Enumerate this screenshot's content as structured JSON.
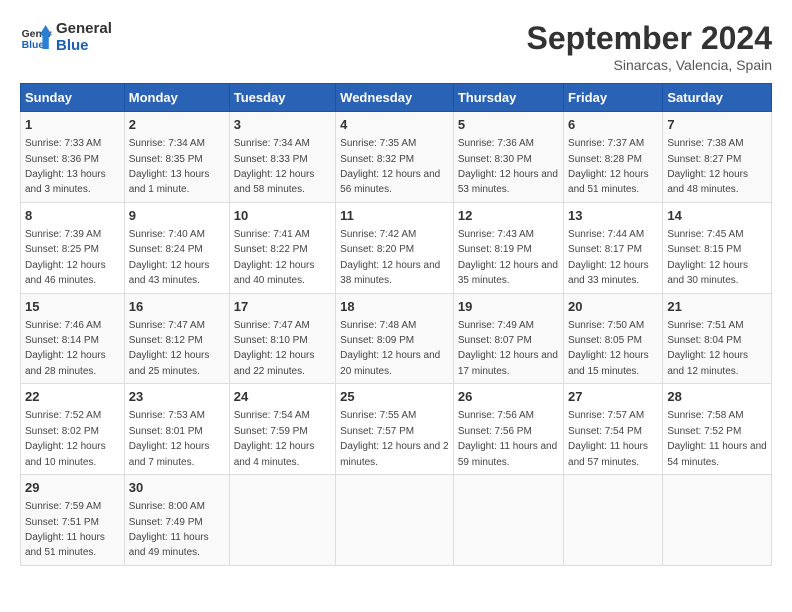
{
  "header": {
    "logo_line1": "General",
    "logo_line2": "Blue",
    "month_title": "September 2024",
    "location": "Sinarcas, Valencia, Spain"
  },
  "columns": [
    "Sunday",
    "Monday",
    "Tuesday",
    "Wednesday",
    "Thursday",
    "Friday",
    "Saturday"
  ],
  "weeks": [
    [
      {
        "day": "1",
        "sunrise": "7:33 AM",
        "sunset": "8:36 PM",
        "daylight": "13 hours and 3 minutes."
      },
      {
        "day": "2",
        "sunrise": "7:34 AM",
        "sunset": "8:35 PM",
        "daylight": "13 hours and 1 minute."
      },
      {
        "day": "3",
        "sunrise": "7:34 AM",
        "sunset": "8:33 PM",
        "daylight": "12 hours and 58 minutes."
      },
      {
        "day": "4",
        "sunrise": "7:35 AM",
        "sunset": "8:32 PM",
        "daylight": "12 hours and 56 minutes."
      },
      {
        "day": "5",
        "sunrise": "7:36 AM",
        "sunset": "8:30 PM",
        "daylight": "12 hours and 53 minutes."
      },
      {
        "day": "6",
        "sunrise": "7:37 AM",
        "sunset": "8:28 PM",
        "daylight": "12 hours and 51 minutes."
      },
      {
        "day": "7",
        "sunrise": "7:38 AM",
        "sunset": "8:27 PM",
        "daylight": "12 hours and 48 minutes."
      }
    ],
    [
      {
        "day": "8",
        "sunrise": "7:39 AM",
        "sunset": "8:25 PM",
        "daylight": "12 hours and 46 minutes."
      },
      {
        "day": "9",
        "sunrise": "7:40 AM",
        "sunset": "8:24 PM",
        "daylight": "12 hours and 43 minutes."
      },
      {
        "day": "10",
        "sunrise": "7:41 AM",
        "sunset": "8:22 PM",
        "daylight": "12 hours and 40 minutes."
      },
      {
        "day": "11",
        "sunrise": "7:42 AM",
        "sunset": "8:20 PM",
        "daylight": "12 hours and 38 minutes."
      },
      {
        "day": "12",
        "sunrise": "7:43 AM",
        "sunset": "8:19 PM",
        "daylight": "12 hours and 35 minutes."
      },
      {
        "day": "13",
        "sunrise": "7:44 AM",
        "sunset": "8:17 PM",
        "daylight": "12 hours and 33 minutes."
      },
      {
        "day": "14",
        "sunrise": "7:45 AM",
        "sunset": "8:15 PM",
        "daylight": "12 hours and 30 minutes."
      }
    ],
    [
      {
        "day": "15",
        "sunrise": "7:46 AM",
        "sunset": "8:14 PM",
        "daylight": "12 hours and 28 minutes."
      },
      {
        "day": "16",
        "sunrise": "7:47 AM",
        "sunset": "8:12 PM",
        "daylight": "12 hours and 25 minutes."
      },
      {
        "day": "17",
        "sunrise": "7:47 AM",
        "sunset": "8:10 PM",
        "daylight": "12 hours and 22 minutes."
      },
      {
        "day": "18",
        "sunrise": "7:48 AM",
        "sunset": "8:09 PM",
        "daylight": "12 hours and 20 minutes."
      },
      {
        "day": "19",
        "sunrise": "7:49 AM",
        "sunset": "8:07 PM",
        "daylight": "12 hours and 17 minutes."
      },
      {
        "day": "20",
        "sunrise": "7:50 AM",
        "sunset": "8:05 PM",
        "daylight": "12 hours and 15 minutes."
      },
      {
        "day": "21",
        "sunrise": "7:51 AM",
        "sunset": "8:04 PM",
        "daylight": "12 hours and 12 minutes."
      }
    ],
    [
      {
        "day": "22",
        "sunrise": "7:52 AM",
        "sunset": "8:02 PM",
        "daylight": "12 hours and 10 minutes."
      },
      {
        "day": "23",
        "sunrise": "7:53 AM",
        "sunset": "8:01 PM",
        "daylight": "12 hours and 7 minutes."
      },
      {
        "day": "24",
        "sunrise": "7:54 AM",
        "sunset": "7:59 PM",
        "daylight": "12 hours and 4 minutes."
      },
      {
        "day": "25",
        "sunrise": "7:55 AM",
        "sunset": "7:57 PM",
        "daylight": "12 hours and 2 minutes."
      },
      {
        "day": "26",
        "sunrise": "7:56 AM",
        "sunset": "7:56 PM",
        "daylight": "11 hours and 59 minutes."
      },
      {
        "day": "27",
        "sunrise": "7:57 AM",
        "sunset": "7:54 PM",
        "daylight": "11 hours and 57 minutes."
      },
      {
        "day": "28",
        "sunrise": "7:58 AM",
        "sunset": "7:52 PM",
        "daylight": "11 hours and 54 minutes."
      }
    ],
    [
      {
        "day": "29",
        "sunrise": "7:59 AM",
        "sunset": "7:51 PM",
        "daylight": "11 hours and 51 minutes."
      },
      {
        "day": "30",
        "sunrise": "8:00 AM",
        "sunset": "7:49 PM",
        "daylight": "11 hours and 49 minutes."
      },
      null,
      null,
      null,
      null,
      null
    ]
  ],
  "labels": {
    "sunrise": "Sunrise:",
    "sunset": "Sunset:",
    "daylight": "Daylight:"
  }
}
